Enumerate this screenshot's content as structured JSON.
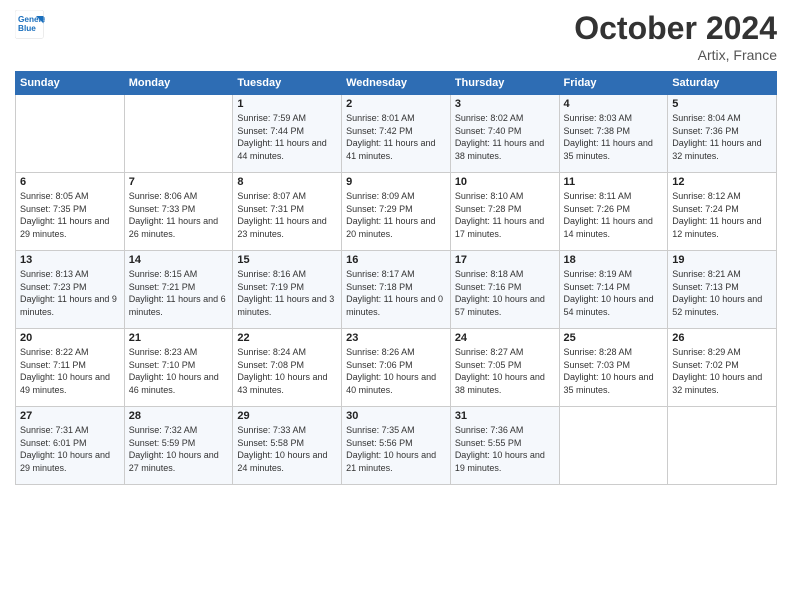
{
  "logo": {
    "line1": "General",
    "line2": "Blue"
  },
  "header": {
    "month": "October 2024",
    "location": "Artix, France"
  },
  "weekdays": [
    "Sunday",
    "Monday",
    "Tuesday",
    "Wednesday",
    "Thursday",
    "Friday",
    "Saturday"
  ],
  "weeks": [
    [
      {
        "day": "",
        "sunrise": "",
        "sunset": "",
        "daylight": ""
      },
      {
        "day": "",
        "sunrise": "",
        "sunset": "",
        "daylight": ""
      },
      {
        "day": "1",
        "sunrise": "Sunrise: 7:59 AM",
        "sunset": "Sunset: 7:44 PM",
        "daylight": "Daylight: 11 hours and 44 minutes."
      },
      {
        "day": "2",
        "sunrise": "Sunrise: 8:01 AM",
        "sunset": "Sunset: 7:42 PM",
        "daylight": "Daylight: 11 hours and 41 minutes."
      },
      {
        "day": "3",
        "sunrise": "Sunrise: 8:02 AM",
        "sunset": "Sunset: 7:40 PM",
        "daylight": "Daylight: 11 hours and 38 minutes."
      },
      {
        "day": "4",
        "sunrise": "Sunrise: 8:03 AM",
        "sunset": "Sunset: 7:38 PM",
        "daylight": "Daylight: 11 hours and 35 minutes."
      },
      {
        "day": "5",
        "sunrise": "Sunrise: 8:04 AM",
        "sunset": "Sunset: 7:36 PM",
        "daylight": "Daylight: 11 hours and 32 minutes."
      }
    ],
    [
      {
        "day": "6",
        "sunrise": "Sunrise: 8:05 AM",
        "sunset": "Sunset: 7:35 PM",
        "daylight": "Daylight: 11 hours and 29 minutes."
      },
      {
        "day": "7",
        "sunrise": "Sunrise: 8:06 AM",
        "sunset": "Sunset: 7:33 PM",
        "daylight": "Daylight: 11 hours and 26 minutes."
      },
      {
        "day": "8",
        "sunrise": "Sunrise: 8:07 AM",
        "sunset": "Sunset: 7:31 PM",
        "daylight": "Daylight: 11 hours and 23 minutes."
      },
      {
        "day": "9",
        "sunrise": "Sunrise: 8:09 AM",
        "sunset": "Sunset: 7:29 PM",
        "daylight": "Daylight: 11 hours and 20 minutes."
      },
      {
        "day": "10",
        "sunrise": "Sunrise: 8:10 AM",
        "sunset": "Sunset: 7:28 PM",
        "daylight": "Daylight: 11 hours and 17 minutes."
      },
      {
        "day": "11",
        "sunrise": "Sunrise: 8:11 AM",
        "sunset": "Sunset: 7:26 PM",
        "daylight": "Daylight: 11 hours and 14 minutes."
      },
      {
        "day": "12",
        "sunrise": "Sunrise: 8:12 AM",
        "sunset": "Sunset: 7:24 PM",
        "daylight": "Daylight: 11 hours and 12 minutes."
      }
    ],
    [
      {
        "day": "13",
        "sunrise": "Sunrise: 8:13 AM",
        "sunset": "Sunset: 7:23 PM",
        "daylight": "Daylight: 11 hours and 9 minutes."
      },
      {
        "day": "14",
        "sunrise": "Sunrise: 8:15 AM",
        "sunset": "Sunset: 7:21 PM",
        "daylight": "Daylight: 11 hours and 6 minutes."
      },
      {
        "day": "15",
        "sunrise": "Sunrise: 8:16 AM",
        "sunset": "Sunset: 7:19 PM",
        "daylight": "Daylight: 11 hours and 3 minutes."
      },
      {
        "day": "16",
        "sunrise": "Sunrise: 8:17 AM",
        "sunset": "Sunset: 7:18 PM",
        "daylight": "Daylight: 11 hours and 0 minutes."
      },
      {
        "day": "17",
        "sunrise": "Sunrise: 8:18 AM",
        "sunset": "Sunset: 7:16 PM",
        "daylight": "Daylight: 10 hours and 57 minutes."
      },
      {
        "day": "18",
        "sunrise": "Sunrise: 8:19 AM",
        "sunset": "Sunset: 7:14 PM",
        "daylight": "Daylight: 10 hours and 54 minutes."
      },
      {
        "day": "19",
        "sunrise": "Sunrise: 8:21 AM",
        "sunset": "Sunset: 7:13 PM",
        "daylight": "Daylight: 10 hours and 52 minutes."
      }
    ],
    [
      {
        "day": "20",
        "sunrise": "Sunrise: 8:22 AM",
        "sunset": "Sunset: 7:11 PM",
        "daylight": "Daylight: 10 hours and 49 minutes."
      },
      {
        "day": "21",
        "sunrise": "Sunrise: 8:23 AM",
        "sunset": "Sunset: 7:10 PM",
        "daylight": "Daylight: 10 hours and 46 minutes."
      },
      {
        "day": "22",
        "sunrise": "Sunrise: 8:24 AM",
        "sunset": "Sunset: 7:08 PM",
        "daylight": "Daylight: 10 hours and 43 minutes."
      },
      {
        "day": "23",
        "sunrise": "Sunrise: 8:26 AM",
        "sunset": "Sunset: 7:06 PM",
        "daylight": "Daylight: 10 hours and 40 minutes."
      },
      {
        "day": "24",
        "sunrise": "Sunrise: 8:27 AM",
        "sunset": "Sunset: 7:05 PM",
        "daylight": "Daylight: 10 hours and 38 minutes."
      },
      {
        "day": "25",
        "sunrise": "Sunrise: 8:28 AM",
        "sunset": "Sunset: 7:03 PM",
        "daylight": "Daylight: 10 hours and 35 minutes."
      },
      {
        "day": "26",
        "sunrise": "Sunrise: 8:29 AM",
        "sunset": "Sunset: 7:02 PM",
        "daylight": "Daylight: 10 hours and 32 minutes."
      }
    ],
    [
      {
        "day": "27",
        "sunrise": "Sunrise: 7:31 AM",
        "sunset": "Sunset: 6:01 PM",
        "daylight": "Daylight: 10 hours and 29 minutes."
      },
      {
        "day": "28",
        "sunrise": "Sunrise: 7:32 AM",
        "sunset": "Sunset: 5:59 PM",
        "daylight": "Daylight: 10 hours and 27 minutes."
      },
      {
        "day": "29",
        "sunrise": "Sunrise: 7:33 AM",
        "sunset": "Sunset: 5:58 PM",
        "daylight": "Daylight: 10 hours and 24 minutes."
      },
      {
        "day": "30",
        "sunrise": "Sunrise: 7:35 AM",
        "sunset": "Sunset: 5:56 PM",
        "daylight": "Daylight: 10 hours and 21 minutes."
      },
      {
        "day": "31",
        "sunrise": "Sunrise: 7:36 AM",
        "sunset": "Sunset: 5:55 PM",
        "daylight": "Daylight: 10 hours and 19 minutes."
      },
      {
        "day": "",
        "sunrise": "",
        "sunset": "",
        "daylight": ""
      },
      {
        "day": "",
        "sunrise": "",
        "sunset": "",
        "daylight": ""
      }
    ]
  ]
}
